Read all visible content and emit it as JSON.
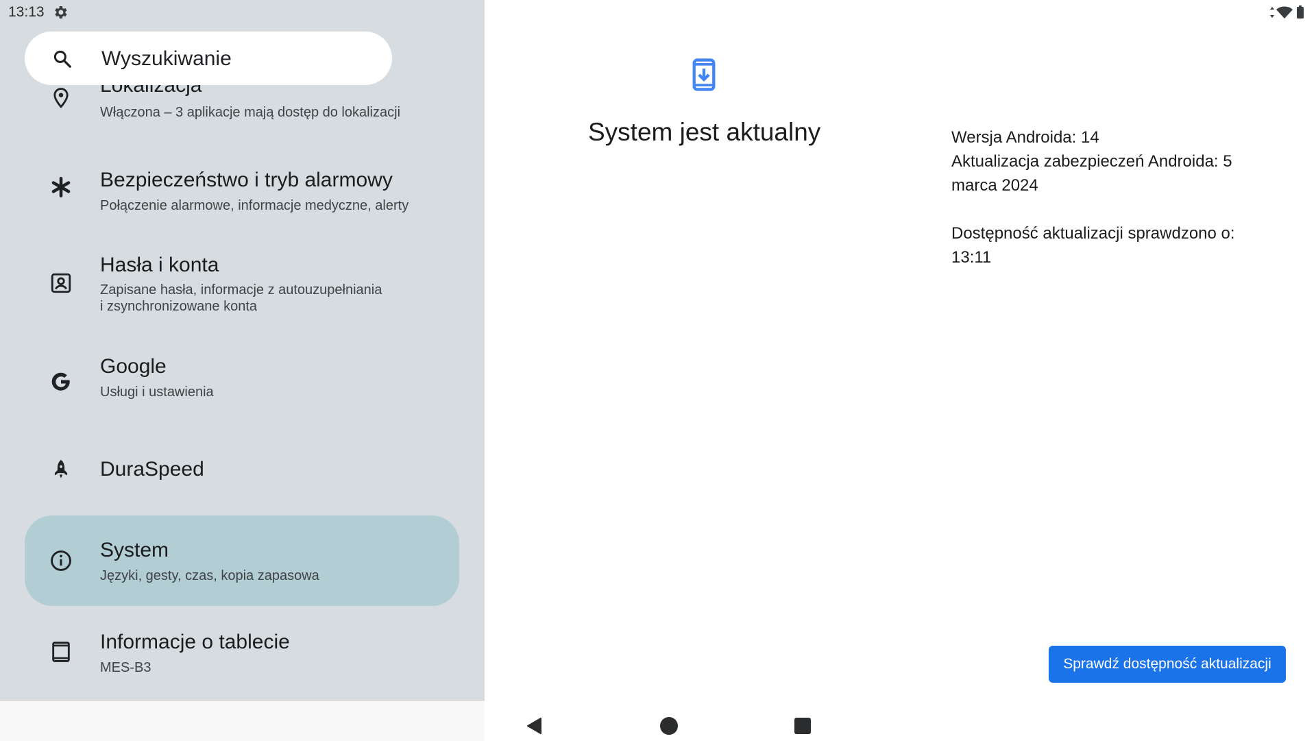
{
  "status_bar": {
    "time": "13:13"
  },
  "search": {
    "placeholder": "Wyszukiwanie"
  },
  "settings_items": [
    {
      "title": "Lokalizacja",
      "subtitle": "Włączona – 3 aplikacje mają dostęp do lokalizacji",
      "icon": "location-pin-icon"
    },
    {
      "title": "Bezpieczeństwo i tryb alarmowy",
      "subtitle": "Połączenie alarmowe, informacje medyczne, alerty",
      "icon": "asterisk-icon"
    },
    {
      "title": "Hasła i konta",
      "subtitle_lines": [
        "Zapisane hasła, informacje z autouzupełniania",
        "i zsynchronizowane konta"
      ],
      "icon": "account-box-icon"
    },
    {
      "title": "Google",
      "subtitle": "Usługi i ustawienia",
      "icon": "google-g-icon"
    },
    {
      "title": "DuraSpeed",
      "icon": "rocket-icon"
    },
    {
      "title": "System",
      "subtitle": "Języki, gesty, czas, kopia zapasowa",
      "icon": "info-icon",
      "selected": true
    },
    {
      "title": "Informacje o tablecie",
      "subtitle": "MES-B3",
      "icon": "tablet-icon"
    }
  ],
  "detail": {
    "title": "System jest aktualny",
    "android_version": "Wersja Androida: 14",
    "security_update_line1": "Aktualizacja zabezpieczeń Androida: 5",
    "security_update_line2": "marca 2024",
    "checked_line1": "Dostępność aktualizacji sprawdzono o:",
    "checked_line2": "13:11",
    "button_label": "Sprawdź dostępność aktualizacji"
  },
  "colors": {
    "accent": "#1a73e8",
    "sidebar_bg": "#d6dcdf",
    "selected_bg": "#b3cdd4",
    "icon_blue": "#4285f4"
  }
}
